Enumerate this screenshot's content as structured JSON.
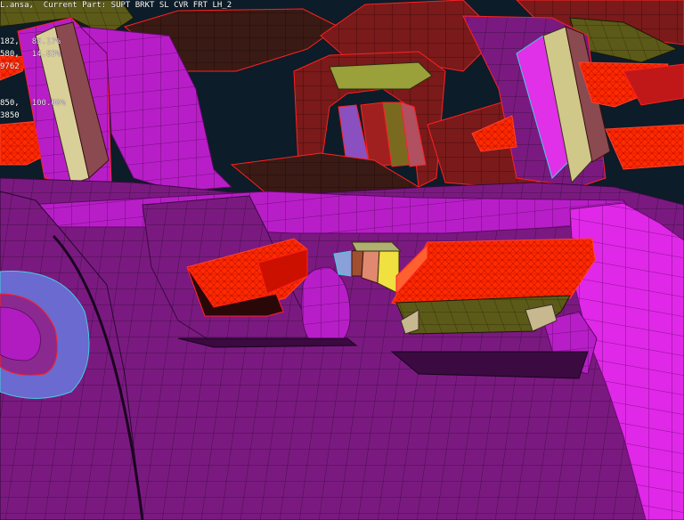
{
  "header": {
    "file_fragment": "L.ansa,",
    "current_part_label": "Current Part:",
    "current_part_name": "SUPT BRKT SL CVR FRT LH_2"
  },
  "stats": [
    {
      "value": "182,",
      "percent": "85.17%"
    },
    {
      "value": "580,",
      "percent": "14.83%"
    },
    {
      "value": "9762",
      "percent": ""
    },
    {
      "value": "850,",
      "percent": "100.00%"
    },
    {
      "value": "3850",
      "percent": ""
    }
  ],
  "colors": {
    "background": "#0c1c28",
    "mesh_magenta": "#b01cc0",
    "mesh_purple": "#7a1a80",
    "mesh_dark_red": "#7a1a1a",
    "mesh_olive": "#5a5a18",
    "mesh_red_triangles": "#ff2200",
    "edge_red": "#ff2020",
    "edge_cyan": "#40d0e0"
  }
}
